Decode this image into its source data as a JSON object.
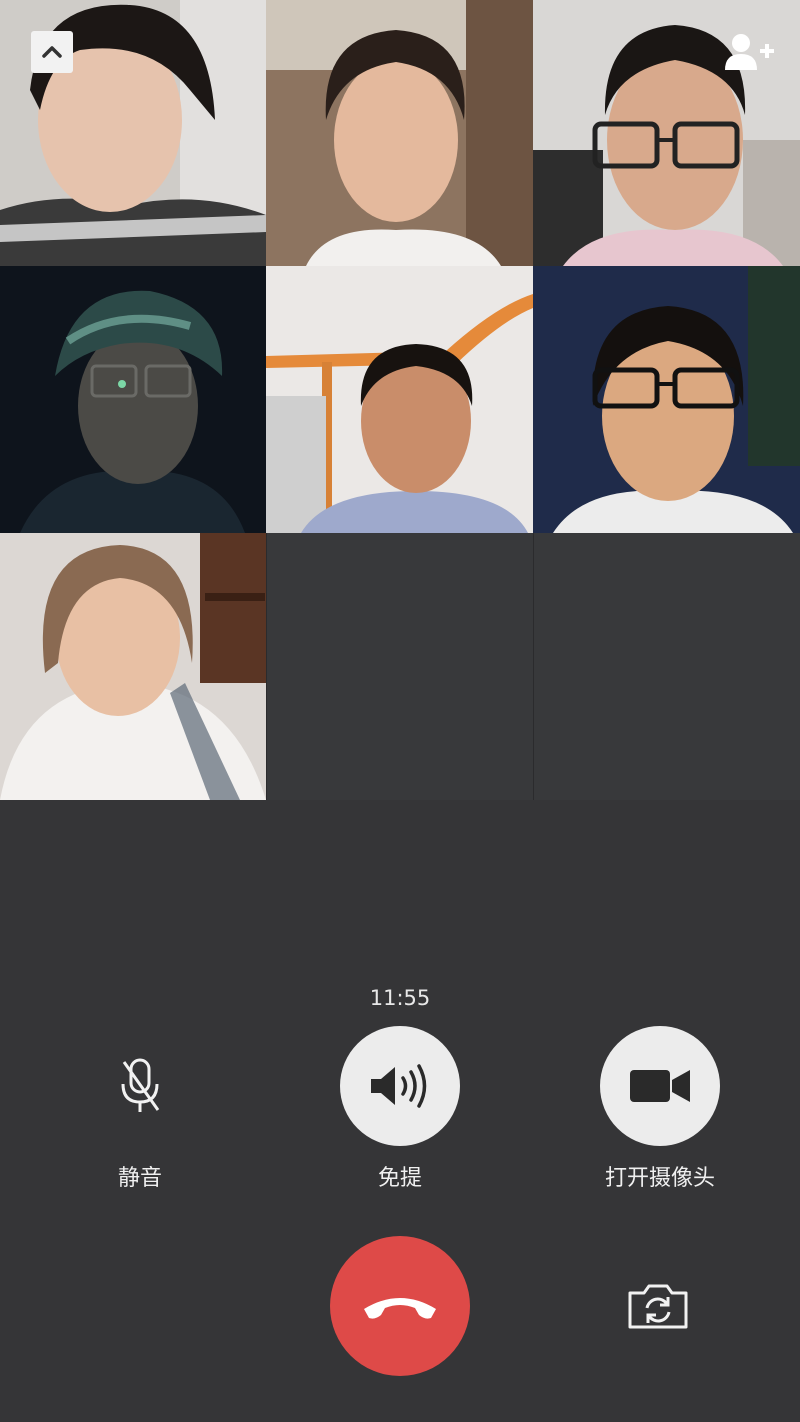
{
  "call": {
    "timer": "11:55"
  },
  "participants": [
    {
      "id": "p1",
      "bg": "#c9c6c2"
    },
    {
      "id": "p2",
      "bg": "#8a6c56"
    },
    {
      "id": "p3",
      "bg": "#d8d6d4"
    },
    {
      "id": "p4",
      "bg": "#0f1620"
    },
    {
      "id": "p5",
      "bg": "#e9e6e4"
    },
    {
      "id": "p6",
      "bg": "#1e2a48"
    },
    {
      "id": "p7",
      "bg": "#dcd6d2"
    }
  ],
  "controls": {
    "mute_label": "静音",
    "speaker_label": "免提",
    "camera_label": "打开摄像头"
  },
  "icons": {
    "collapse": "chevron-up-icon",
    "add_member": "add-person-icon",
    "mute": "microphone-off-icon",
    "speaker": "speaker-icon",
    "camera": "video-camera-icon",
    "hangup": "phone-hangup-icon",
    "flip": "camera-switch-icon"
  },
  "colors": {
    "background": "#353537",
    "hangup": "#de4a48",
    "button_light": "#ececec"
  }
}
